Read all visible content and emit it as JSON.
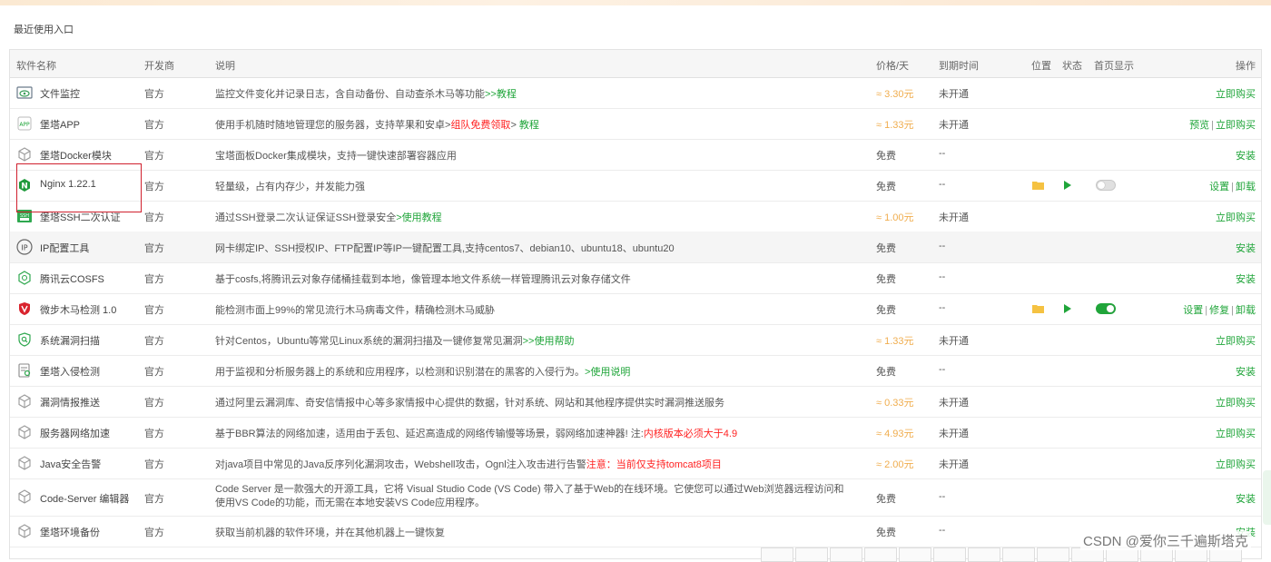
{
  "recent_entry": "最近使用入口",
  "headers": {
    "name": "软件名称",
    "developer": "开发商",
    "description": "说明",
    "price": "价格/天",
    "expire": "到期时间",
    "position": "位置",
    "status": "状态",
    "homepage": "首页显示",
    "action": "操作"
  },
  "rows": [
    {
      "name": "文件监控",
      "icon": "eye-file-icon",
      "dev": "官方",
      "desc": "监控文件变化并记录日志，含自动备份、自动查杀木马等功能",
      "desc_link": ">>教程",
      "desc_extra": "",
      "price": "≈ 3.30元",
      "expire": "未开通",
      "action1": "立即购买",
      "action2": "",
      "action3": ""
    },
    {
      "name": "堡塔APP",
      "icon": "app-icon",
      "dev": "官方",
      "desc": "使用手机随时随地管理您的服务器，支持苹果和安卓>",
      "desc_link": " 教程",
      "desc_extra": "组队免费领取",
      "price": "≈ 1.33元",
      "expire": "未开通",
      "action1": "预览",
      "action2": "立即购买",
      "action3": ""
    },
    {
      "name": "堡塔Docker模块",
      "icon": "cube-icon",
      "dev": "官方",
      "desc": "宝塔面板Docker集成模块，支持一键快速部署容器应用",
      "desc_link": "",
      "desc_extra": "",
      "price": "免费",
      "expire": "--",
      "action1": "安装",
      "action2": "",
      "action3": ""
    },
    {
      "name": "Nginx 1.22.1",
      "icon": "nginx-icon",
      "dev": "官方",
      "desc": "轻量级，占有内存少，并发能力强",
      "desc_link": "",
      "desc_extra": "",
      "price": "免费",
      "expire": "--",
      "action1": "设置",
      "action2": "卸载",
      "action3": ""
    },
    {
      "name": "堡塔SSH二次认证",
      "icon": "ssh-auth-icon",
      "dev": "官方",
      "desc": "通过SSH登录二次认证保证SSH登录安全",
      "desc_link": ">使用教程",
      "desc_extra": "",
      "price": "≈ 1.00元",
      "expire": "未开通",
      "action1": "立即购买",
      "action2": "",
      "action3": ""
    },
    {
      "name": "IP配置工具",
      "icon": "ip-icon",
      "dev": "官方",
      "desc": "网卡绑定IP、SSH授权IP、FTP配置IP等IP一键配置工具,支持centos7、debian10、ubuntu18、ubuntu20",
      "desc_link": "",
      "desc_extra": "",
      "price": "免费",
      "expire": "--",
      "action1": "安装",
      "action2": "",
      "action3": ""
    },
    {
      "name": "腾讯云COSFS",
      "icon": "cloud-cube-icon",
      "dev": "官方",
      "desc": "基于cosfs,将腾讯云对象存储桶挂载到本地，像管理本地文件系统一样管理腾讯云对象存储文件",
      "desc_link": "",
      "desc_extra": "",
      "price": "免费",
      "expire": "--",
      "action1": "安装",
      "action2": "",
      "action3": ""
    },
    {
      "name": "微步木马检测 1.0",
      "icon": "shield-icon",
      "dev": "官方",
      "desc": "能检测市面上99%的常见流行木马病毒文件，精确检测木马威胁",
      "desc_link": "",
      "desc_extra": "",
      "price": "免费",
      "expire": "--",
      "action1": "设置",
      "action2": "修复",
      "action3": "卸载"
    },
    {
      "name": "系统漏洞扫描",
      "icon": "scan-icon",
      "dev": "官方",
      "desc": "针对Centos，Ubuntu等常见Linux系统的漏洞扫描及一键修复常见漏洞",
      "desc_link": ">>使用帮助",
      "desc_extra": "",
      "price": "≈ 1.33元",
      "expire": "未开通",
      "action1": "立即购买",
      "action2": "",
      "action3": ""
    },
    {
      "name": "堡塔入侵检测",
      "icon": "intrusion-icon",
      "dev": "官方",
      "desc": "用于监视和分析服务器上的系统和应用程序，以检测和识别潜在的黑客的入侵行为。",
      "desc_link": ">使用说明",
      "desc_extra": "",
      "price": "免费",
      "expire": "--",
      "action1": "安装",
      "action2": "",
      "action3": ""
    },
    {
      "name": "漏洞情报推送",
      "icon": "cube-icon",
      "dev": "官方",
      "desc": "通过阿里云漏洞库、奇安信情报中心等多家情报中心提供的数据，针对系统、网站和其他程序提供实时漏洞推送服务",
      "desc_link": "",
      "desc_extra": "",
      "price": "≈ 0.33元",
      "expire": "未开通",
      "action1": "立即购买",
      "action2": "",
      "action3": ""
    },
    {
      "name": "服务器网络加速",
      "icon": "cube-icon",
      "dev": "官方",
      "desc": "基于BBR算法的网络加速，适用由于丢包、延迟高造成的网络传输慢等场景，弱网络加速神器! 注:",
      "desc_link": "",
      "desc_extra": "内核版本必须大于4.9",
      "price": "≈ 4.93元",
      "expire": "未开通",
      "action1": "立即购买",
      "action2": "",
      "action3": ""
    },
    {
      "name": "Java安全告警",
      "icon": "cube-icon",
      "dev": "官方",
      "desc": "对java项目中常见的Java反序列化漏洞攻击，Webshell攻击，Ognl注入攻击进行告警",
      "desc_link": "",
      "desc_extra": "注意：当前仅支持tomcat8项目",
      "price": "≈ 2.00元",
      "expire": "未开通",
      "action1": "立即购买",
      "action2": "",
      "action3": ""
    },
    {
      "name": "Code-Server 编辑器",
      "icon": "cube-icon",
      "dev": "官方",
      "desc": "Code Server 是一款强大的开源工具，它将 Visual Studio Code (VS Code) 带入了基于Web的在线环境。它使您可以通过Web浏览器远程访问和使用VS Code的功能，而无需在本地安装VS Code应用程序。",
      "desc_link": "",
      "desc_extra": "",
      "price": "免费",
      "expire": "--",
      "action1": "安装",
      "action2": "",
      "action3": ""
    },
    {
      "name": "堡塔环境备份",
      "icon": "cube-icon",
      "dev": "官方",
      "desc": "获取当前机器的软件环境，并在其他机器上一键恢复",
      "desc_link": "",
      "desc_extra": "",
      "price": "免费",
      "expire": "--",
      "action1": "安装",
      "action2": "",
      "action3": ""
    }
  ],
  "watermark": "CSDN @爱你三千遍斯塔克",
  "colors": {
    "accent_green": "#20a53a",
    "price_orange": "#f0ad4e",
    "warning_red": "#ff2222",
    "highlight_box": "#d0202e"
  }
}
